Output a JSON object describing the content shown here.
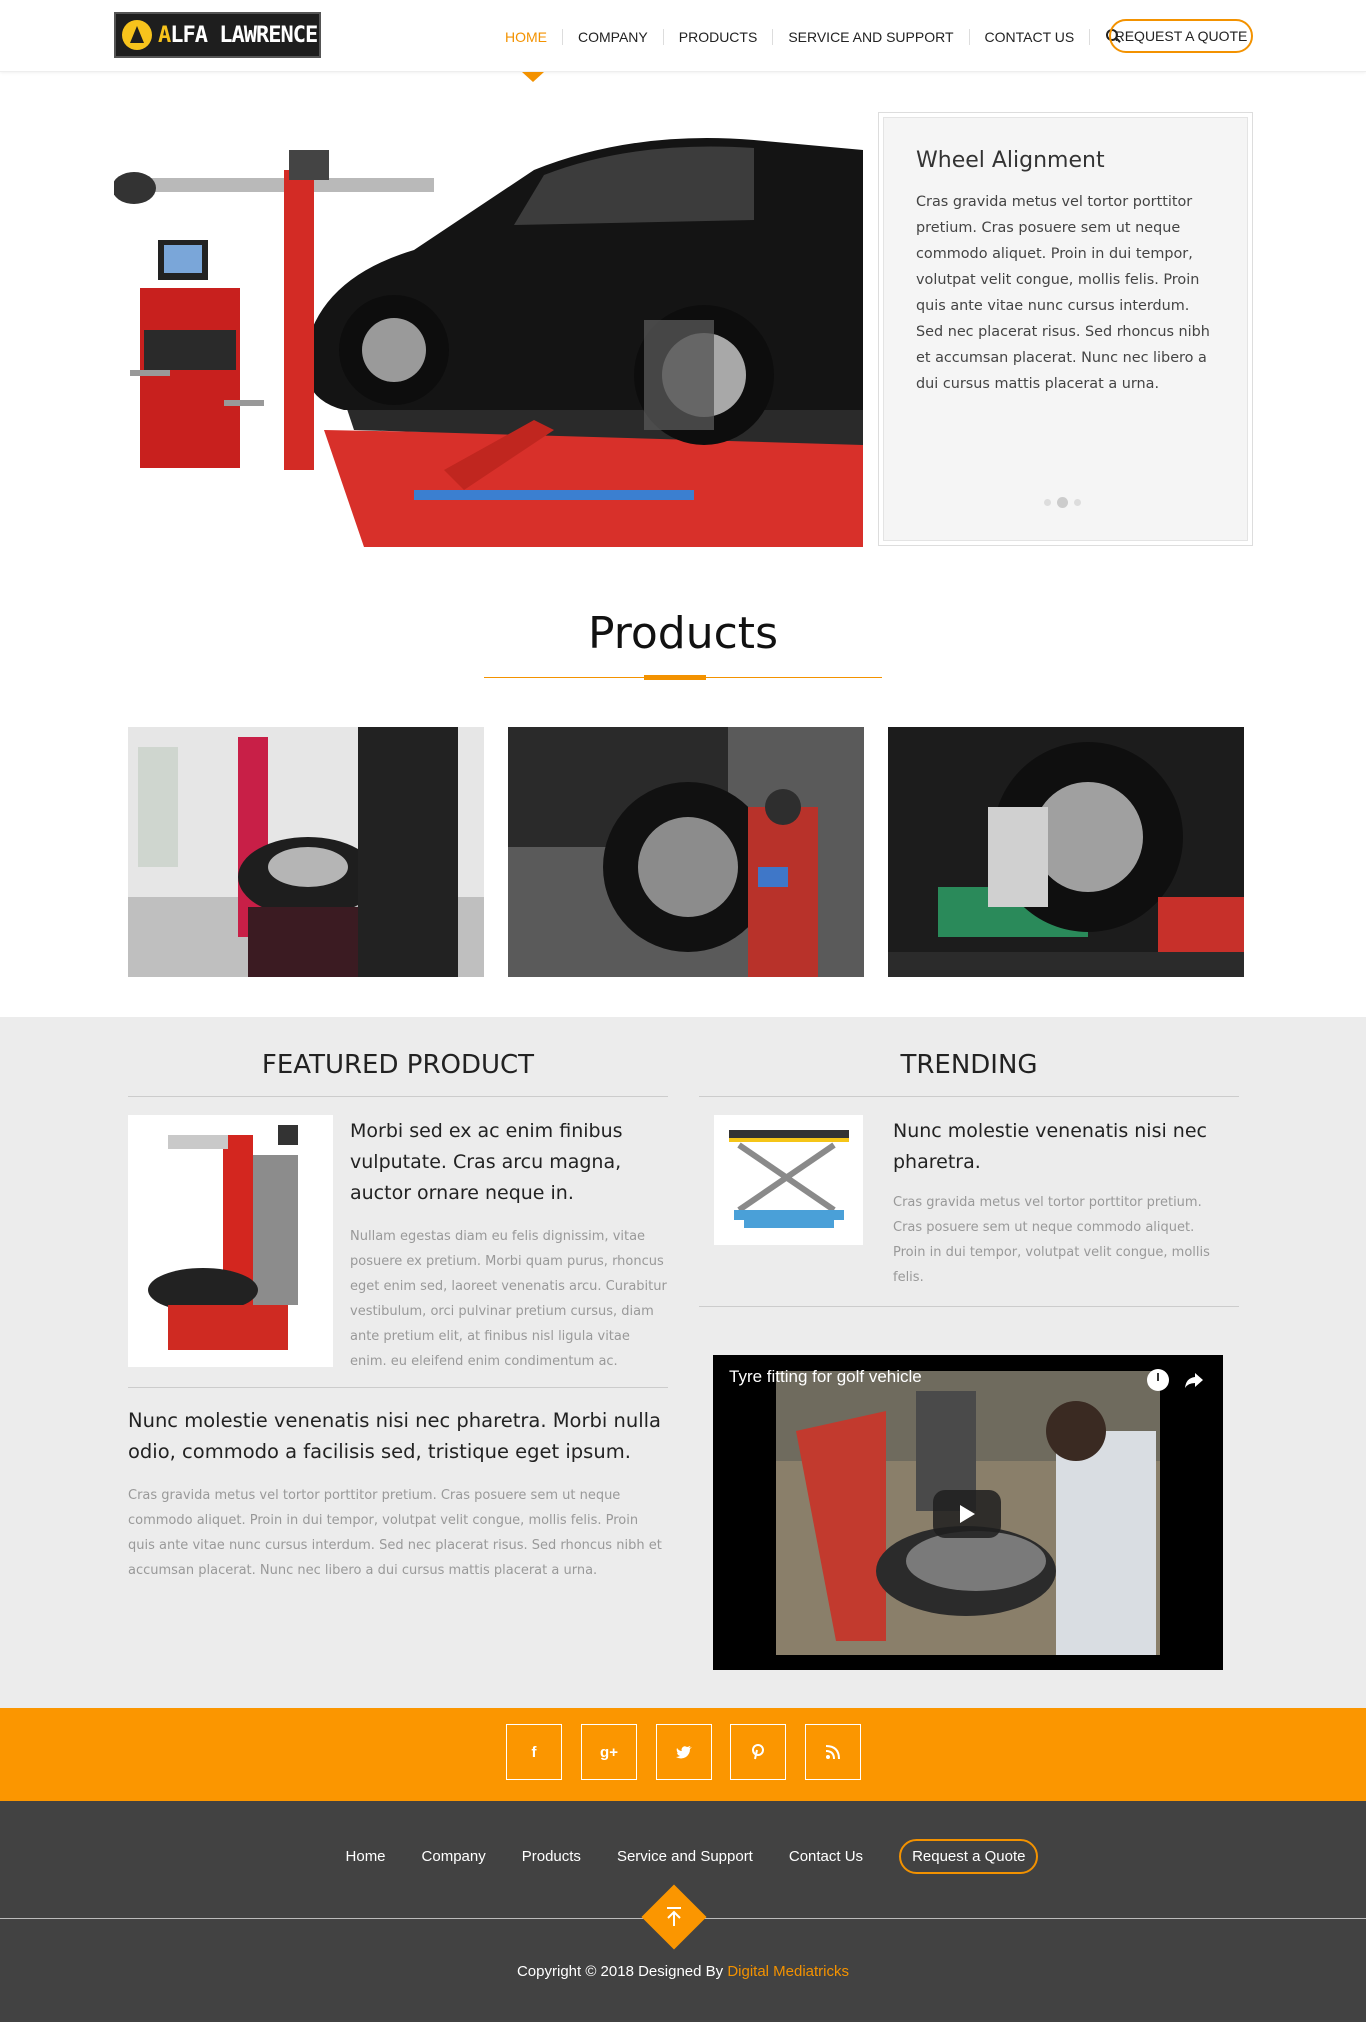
{
  "header": {
    "logo_text_a": "A",
    "logo_text": "LFA LAWRENCE",
    "nav": [
      "HOME",
      "COMPANY",
      "PRODUCTS",
      "SERVICE AND SUPPORT",
      "CONTACT US"
    ],
    "quote_button": "REQUEST A QUOTE"
  },
  "hero": {
    "title": "Wheel Alignment",
    "text": "Cras gravida metus vel tortor porttitor pretium. Cras posuere sem ut neque commodo aliquet. Proin in dui tempor, volutpat velit congue, mollis felis. Proin quis ante vitae nunc cursus interdum. Sed nec placerat risus. Sed rhoncus nibh et accumsan placerat. Nunc nec libero a dui cursus mattis placerat a urna."
  },
  "products": {
    "title": "Products"
  },
  "featured": {
    "heading": "FEATURED PRODUCT",
    "item_title": "Morbi sed ex ac enim finibus vulputate. Cras arcu magna, auctor ornare neque in.",
    "item_text": "Nullam egestas diam eu felis dignissim, vitae posuere ex pretium. Morbi quam purus, rhoncus eget enim sed, laoreet venenatis arcu. Curabitur vestibulum, orci pulvinar pretium cursus, diam ante pretium elit, at finibus nisl ligula vitae enim. eu eleifend enim condimentum ac.",
    "item2_title": "Nunc molestie venenatis nisi nec pharetra. Morbi nulla odio, commodo a facilisis sed, tristique eget ipsum.",
    "item2_text": "Cras gravida metus vel tortor porttitor pretium. Cras posuere sem ut neque commodo aliquet. Proin in dui tempor, volutpat velit congue, mollis felis. Proin quis ante vitae nunc cursus interdum. Sed nec placerat risus. Sed rhoncus nibh et accumsan placerat. Nunc nec libero a dui cursus mattis placerat a urna."
  },
  "trending": {
    "heading": "TRENDING",
    "item_title": "Nunc molestie venenatis nisi nec pharetra.",
    "item_text": "Cras gravida metus vel tortor porttitor pretium. Cras posuere sem ut neque commodo aliquet. Proin in dui tempor, volutpat velit congue, mollis felis.",
    "video_title": "Tyre fitting for golf vehicle"
  },
  "social": [
    "f",
    "g+",
    "twitter-icon",
    "pinterest-icon",
    "rss-icon"
  ],
  "footer": {
    "links": [
      "Home",
      "Company",
      "Products",
      "Service and Support",
      "Contact Us"
    ],
    "quote_button": "Request a Quote",
    "copyright": "Copyright © 2018 Designed By ",
    "brand": "Digital Mediatricks"
  },
  "colors": {
    "accent": "#f39200",
    "orange_bar": "#fb9600",
    "footer": "#424242",
    "gray_section": "#ececec"
  }
}
